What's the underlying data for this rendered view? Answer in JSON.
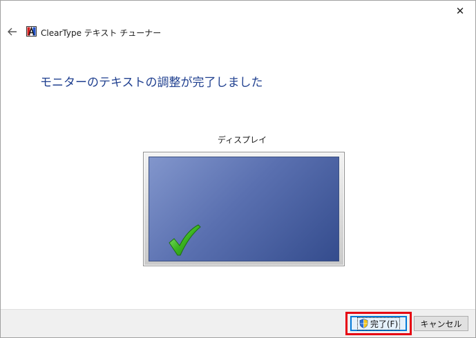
{
  "window": {
    "close_glyph": "✕"
  },
  "titlebar": {
    "app_title": "ClearType テキスト チューナー",
    "back_icon": "back-arrow-icon",
    "app_icon": "cleartype-app-icon"
  },
  "main": {
    "heading": "モニターのテキストの調整が完了しました",
    "display_label": "ディスプレイ",
    "check_icon": "checkmark-icon"
  },
  "footer": {
    "finish_label": "完了(F)",
    "cancel_label": "キャンセル",
    "shield_icon": "uac-shield-icon"
  },
  "colors": {
    "heading": "#1f3f8f",
    "highlight": "#e60012",
    "screen_dark": "#344c8d",
    "screen_light": "#8296cc",
    "check_green": "#3cb521"
  }
}
